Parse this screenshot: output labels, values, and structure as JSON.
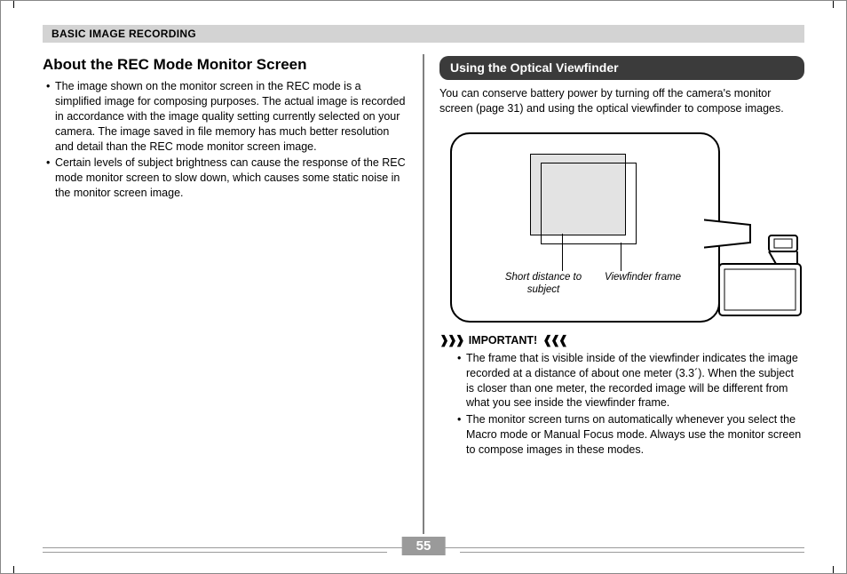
{
  "header": {
    "title": "BASIC IMAGE RECORDING"
  },
  "left": {
    "heading": "About the REC Mode Monitor Screen",
    "bullets": [
      "The image shown on the monitor screen in the REC mode is a simplified image for composing purposes. The actual image is recorded in accordance with the image quality setting currently selected on your camera. The image saved in file memory has much better resolution and detail than the REC mode monitor screen image.",
      "Certain levels of subject brightness can cause the response of the REC mode monitor screen to slow down, which causes some static noise in the monitor screen image."
    ]
  },
  "right": {
    "pill": "Using the Optical Viewfinder",
    "intro": "You can conserve battery power by turning off the camera's monitor screen (page 31) and using the optical viewfinder to compose images.",
    "diagram": {
      "label_short_distance": "Short distance to subject",
      "label_viewfinder_frame": "Viewfinder frame"
    },
    "important_label": "IMPORTANT!",
    "important_bullets": [
      "The frame that is visible inside of the viewfinder indicates the image recorded at a distance of about one meter (3.3´). When the subject is closer than one meter, the recorded image will be different from what you see inside the viewfinder frame.",
      "The monitor screen turns on automatically whenever you select the Macro mode or Manual Focus mode. Always use the monitor screen to compose images in these modes."
    ]
  },
  "page_number": "55"
}
